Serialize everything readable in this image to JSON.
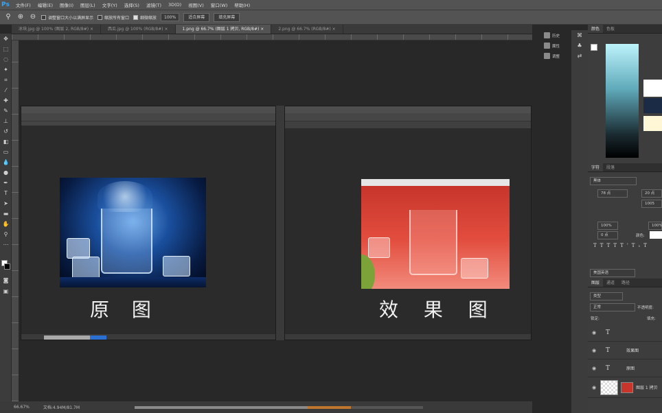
{
  "app": {
    "logo": "Ps"
  },
  "menu": [
    "文件(F)",
    "编辑(E)",
    "图像(I)",
    "图层(L)",
    "文字(Y)",
    "选择(S)",
    "滤镜(T)",
    "3D(D)",
    "视图(V)",
    "窗口(W)",
    "帮助(H)"
  ],
  "options": {
    "resize_windows": "调整窗口大小以满屏显示",
    "zoom_all": "缩放所有窗口",
    "scrubby_zoom": "细微缩放",
    "zoom_value": "100%",
    "fit_screen": "适合屏幕",
    "fill_screen": "填充屏幕"
  },
  "tabs": [
    {
      "label": "冰块.jpg @ 100% (图层 2, RGB/8#) ×"
    },
    {
      "label": "西瓜.jpg @ 100% (RGB/8#) ×"
    },
    {
      "label": "1.png @ 66.7% (图层 1 拷贝, RGB/8#) ×"
    },
    {
      "label": "2.png @ 66.7% (RGB/8#) ×"
    }
  ],
  "captions": {
    "left": "原 图",
    "right": "效 果 图"
  },
  "status": {
    "zoom": "66.67%",
    "doc": "文档:4.94M/81.7M"
  },
  "right_icons": [
    {
      "label": "历史",
      "icon": "history-icon"
    },
    {
      "label": "属性",
      "icon": "properties-icon"
    },
    {
      "label": "调整",
      "icon": "adjust-icon"
    }
  ],
  "panels": {
    "color_tabs": [
      "颜色",
      "色板"
    ],
    "swatch_header": "色板",
    "char_tabs": [
      "字符",
      "段落"
    ],
    "font_name": "黑体",
    "font_size": "78 点",
    "leading": "20 点",
    "tracking": "1005",
    "scale_v": "100%",
    "scale_h": "100%",
    "baseline": "0 点",
    "color_label": "颜色:",
    "lang": "美国英语",
    "layer_tabs": [
      "图层",
      "通道",
      "路径"
    ],
    "kind": "类型",
    "blend": "正常",
    "opacity": "不透明度:",
    "lock": "锁定:",
    "fill": "填充:"
  },
  "layers": [
    {
      "name": "",
      "type": "text"
    },
    {
      "name": "效果图",
      "type": "text"
    },
    {
      "name": "原图",
      "type": "text"
    },
    {
      "name": "图层 1 拷贝",
      "type": "image"
    }
  ],
  "colors": {
    "swatch_white": "#ffffff",
    "swatch_navy": "#1b2a45",
    "swatch_cream": "#fff7d6",
    "accent": "#31a8ff"
  }
}
